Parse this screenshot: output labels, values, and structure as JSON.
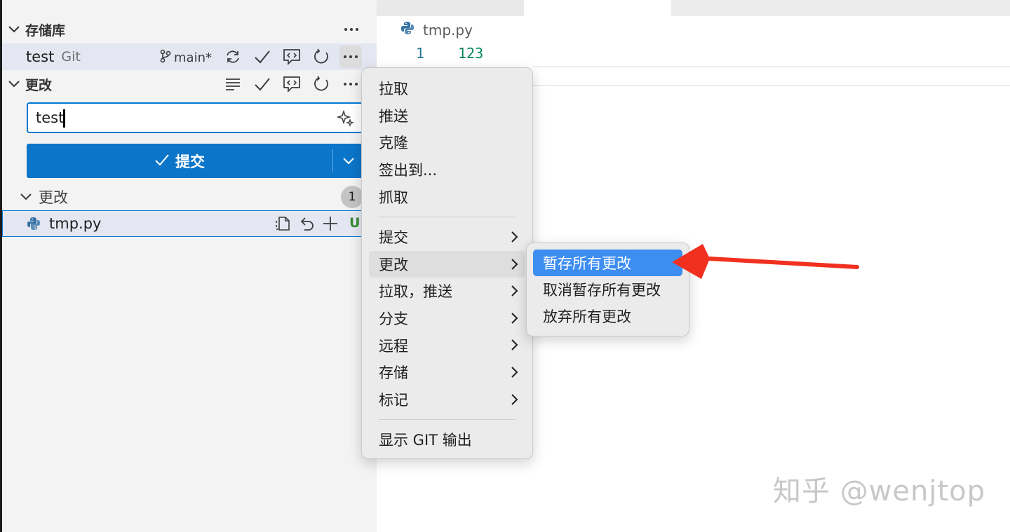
{
  "scm": {
    "repositories_header": "存储库",
    "repo": {
      "name": "test",
      "type": "Git",
      "branch": "main*"
    },
    "changes_header": "更改",
    "commit_message": {
      "value": "test"
    },
    "commit_button": {
      "label": "提交"
    },
    "changes_group": {
      "label": "更改",
      "count": "1"
    },
    "files": [
      {
        "name": "tmp.py",
        "status": "U"
      }
    ]
  },
  "editor": {
    "breadcrumb": "tmp.py",
    "lines": [
      {
        "number": "1",
        "text": "123"
      }
    ]
  },
  "context_menu": {
    "group1": [
      "拉取",
      "推送",
      "克隆",
      "签出到...",
      "抓取"
    ],
    "group2": [
      "提交",
      "更改",
      "拉取，推送",
      "分支",
      "远程",
      "存储",
      "标记"
    ],
    "group3": [
      "显示 GIT 输出"
    ]
  },
  "submenu": {
    "items": [
      "暂存所有更改",
      "取消暂存所有更改",
      "放弃所有更改"
    ]
  },
  "watermark": "知乎 @wenjtop",
  "colors": {
    "accent": "#0b75c9",
    "selection": "#3e8ef1",
    "annotation": "#f1301f",
    "untracked": "#388a34"
  }
}
